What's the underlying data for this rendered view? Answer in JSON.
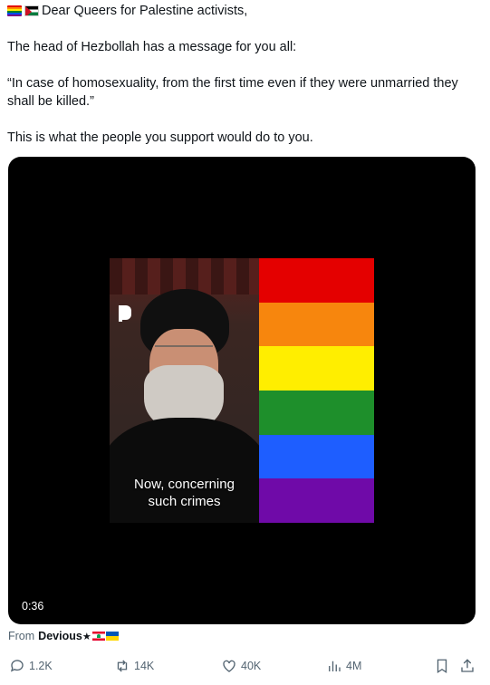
{
  "tweet": {
    "line1": "Dear Queers for Palestine activists,",
    "line2": "The head of Hezbollah has a message for you all:",
    "line3": "“In case of homosexuality, from the first time even if they were unmarried they shall be killed.”",
    "line4": "This is what the people you support would do to you.",
    "leading_emoji": [
      "rainbow-flag-icon",
      "palestine-flag-icon"
    ]
  },
  "video": {
    "caption_line1": "Now, concerning",
    "caption_line2": "such crimes",
    "duration": "0:36",
    "stripe_colors": [
      "#e40000",
      "#f7860d",
      "#ffee00",
      "#1e8f2b",
      "#1e5eff",
      "#6f0aa8"
    ]
  },
  "source": {
    "prefix": "From",
    "account": "Devious",
    "suffix_icons": [
      "star-icon",
      "lebanon-flag-icon",
      "ukraine-flag-icon"
    ]
  },
  "actions": {
    "replies": "1.2K",
    "reposts": "14K",
    "likes": "40K",
    "views": "4M"
  },
  "colors": {
    "text": "#0f1419",
    "muted": "#536471",
    "video_bg": "#000000"
  }
}
